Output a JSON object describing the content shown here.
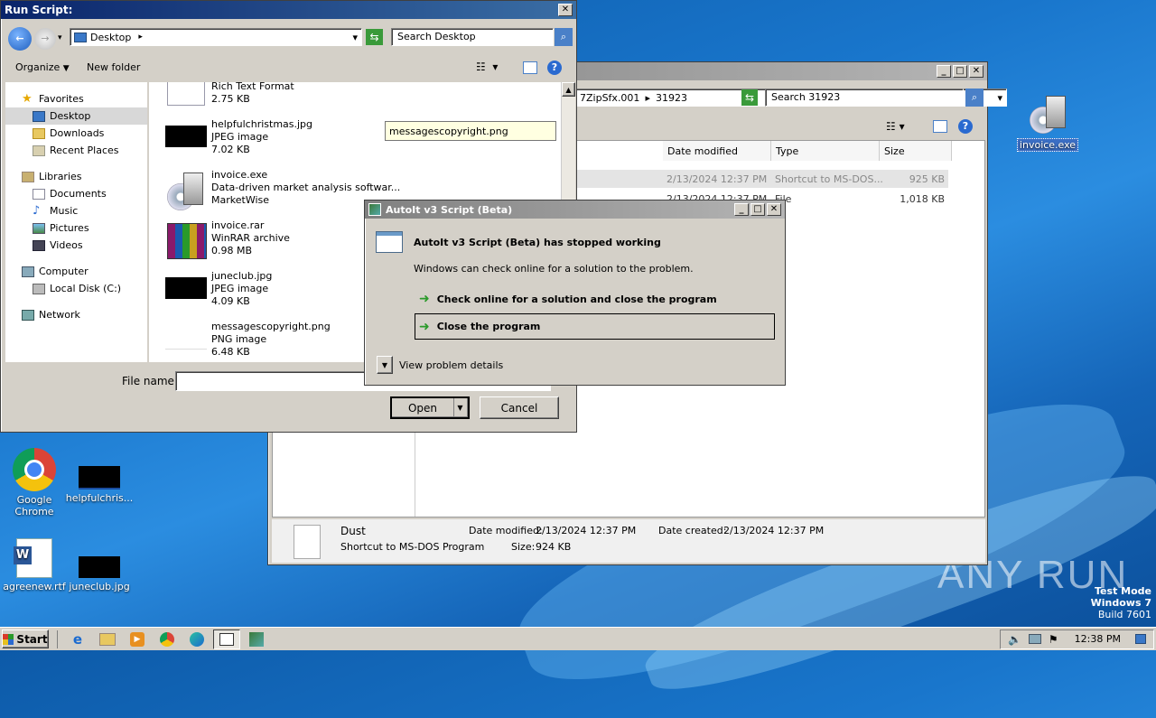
{
  "desktop": {
    "icons": [
      {
        "label": "Google Chrome"
      },
      {
        "label": "helpfulchris..."
      },
      {
        "label": "agreenew.rtf"
      },
      {
        "label": "juneclub.jpg"
      },
      {
        "label": "invoice.exe"
      }
    ],
    "watermark": "ANY RUN",
    "os_text": {
      "line1": "Test Mode",
      "line2": "Windows 7",
      "line3": "Build 7601"
    }
  },
  "run_script": {
    "title": "Run Script:",
    "location": "Desktop",
    "search_placeholder": "Search Desktop",
    "toolbar": {
      "organize": "Organize",
      "new_folder": "New folder"
    },
    "nav": {
      "favorites": "Favorites",
      "favorites_items": [
        "Desktop",
        "Downloads",
        "Recent Places"
      ],
      "libraries": "Libraries",
      "libraries_items": [
        "Documents",
        "Music",
        "Pictures",
        "Videos"
      ],
      "computer": "Computer",
      "computer_items": [
        "Local Disk (C:)"
      ],
      "network": "Network"
    },
    "files": [
      {
        "name": "",
        "type": "Rich Text Format",
        "size": "2.75 KB"
      },
      {
        "name": "helpfulchristmas.jpg",
        "type": "JPEG image",
        "size": "7.02 KB"
      },
      {
        "name": "invoice.exe",
        "type": "Data-driven market analysis softwar...",
        "size": "MarketWise"
      },
      {
        "name": "invoice.rar",
        "type": "WinRAR archive",
        "size": "0.98 MB"
      },
      {
        "name": "juneclub.jpg",
        "type": "JPEG image",
        "size": "4.09 KB"
      },
      {
        "name": "messagescopyright.png",
        "type": "PNG image",
        "size": "6.48 KB"
      }
    ],
    "tooltip": "messagescopyright.png",
    "filename_label": "File name:",
    "filename_value": "",
    "open_button": "Open",
    "cancel_button": "Cancel"
  },
  "explorer": {
    "address": "7ZipSfx.001",
    "address_sep": "▸",
    "address_folder": "31923",
    "search_placeholder": "Search 31923",
    "columns": [
      "Date modified",
      "Type",
      "Size"
    ],
    "rows": [
      {
        "date": "2/13/2024 12:37 PM",
        "type": "Shortcut to MS-DOS...",
        "size": "925 KB"
      },
      {
        "date": "2/13/2024 12:37 PM",
        "type": "File",
        "size": "1,018 KB"
      }
    ],
    "details": {
      "name": "Dust",
      "type": "Shortcut to MS-DOS Program",
      "modified_label": "Date modified:",
      "modified_value": "2/13/2024 12:37 PM",
      "created_label": "Date created:",
      "created_value": "2/13/2024 12:37 PM",
      "size_label": "Size:",
      "size_value": "924 KB"
    }
  },
  "error_dialog": {
    "title": "AutoIt v3 Script (Beta)",
    "heading": "AutoIt v3 Script (Beta) has stopped working",
    "message": "Windows can check online for a solution to the problem.",
    "option1": "Check online for a solution and close the program",
    "option2": "Close the program",
    "details": "View problem details"
  },
  "taskbar": {
    "start": "Start",
    "clock": "12:38 PM"
  }
}
